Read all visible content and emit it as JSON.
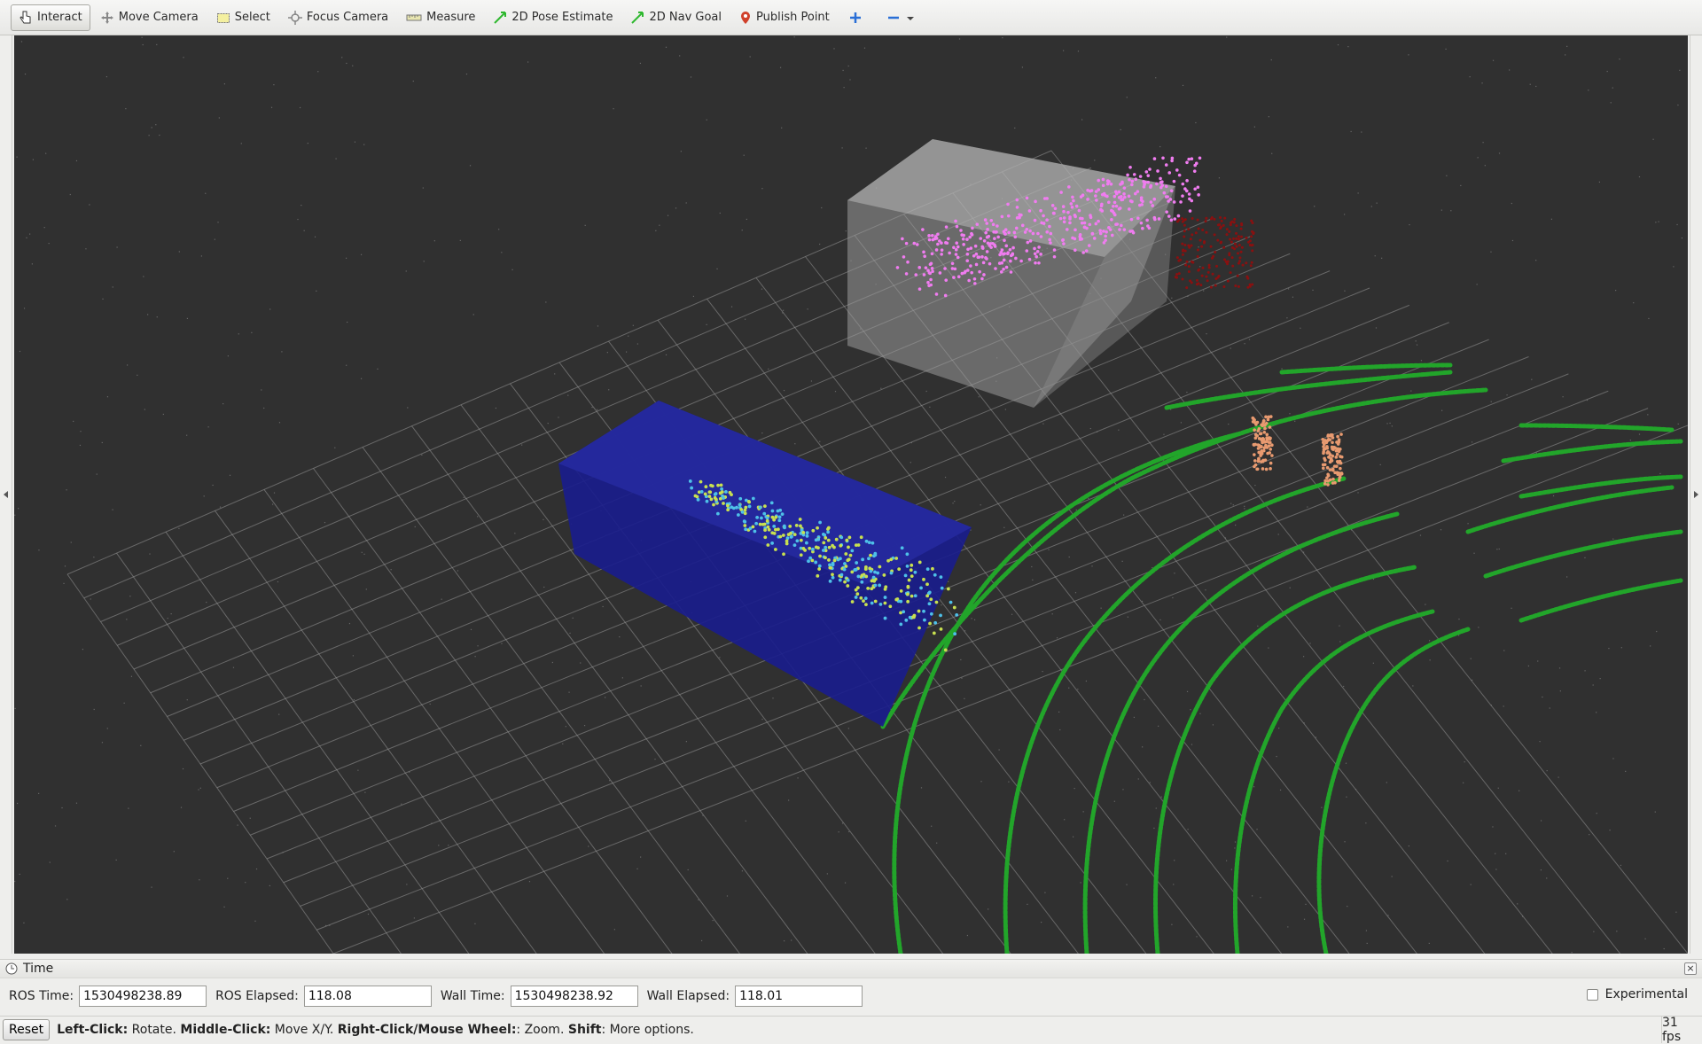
{
  "toolbar": {
    "tools": [
      {
        "label": "Interact",
        "icon": "hand-pointer-icon"
      },
      {
        "label": "Move Camera",
        "icon": "move-arrows-icon"
      },
      {
        "label": "Select",
        "icon": "select-rect-icon"
      },
      {
        "label": "Focus Camera",
        "icon": "crosshair-icon"
      },
      {
        "label": "Measure",
        "icon": "ruler-icon"
      },
      {
        "label": "2D Pose Estimate",
        "icon": "green-arrow-icon"
      },
      {
        "label": "2D Nav Goal",
        "icon": "green-arrow-icon"
      },
      {
        "label": "Publish Point",
        "icon": "map-pin-icon"
      }
    ]
  },
  "time_panel": {
    "title": "Time",
    "ros_time_label": "ROS Time:",
    "ros_time_value": "1530498238.89",
    "ros_elapsed_label": "ROS Elapsed:",
    "ros_elapsed_value": "118.08",
    "wall_time_label": "Wall Time:",
    "wall_time_value": "1530498238.92",
    "wall_elapsed_label": "Wall Elapsed:",
    "wall_elapsed_value": "118.01",
    "experimental_label": "Experimental"
  },
  "status": {
    "reset_label": "Reset",
    "hint_parts": [
      {
        "bold": true,
        "text": "Left-Click:"
      },
      {
        "bold": false,
        "text": " Rotate. "
      },
      {
        "bold": true,
        "text": "Middle-Click:"
      },
      {
        "bold": false,
        "text": " Move X/Y. "
      },
      {
        "bold": true,
        "text": "Right-Click/Mouse Wheel:"
      },
      {
        "bold": false,
        "text": ": Zoom. "
      },
      {
        "bold": true,
        "text": "Shift"
      },
      {
        "bold": false,
        "text": ": More options."
      }
    ],
    "fps": "31 fps"
  },
  "colors": {
    "viewport_bg": "#303030",
    "grid": "#a0a0a0",
    "laser_scan": "#22a52a",
    "box_blue": "#1a1d8c",
    "box_gray": "#9a9a9a",
    "points_magenta": "#f07cf0",
    "points_cyan": "#4ec0e8",
    "points_yellow": "#c8e050",
    "points_red": "#8a1010",
    "points_orange": "#e89a70"
  }
}
